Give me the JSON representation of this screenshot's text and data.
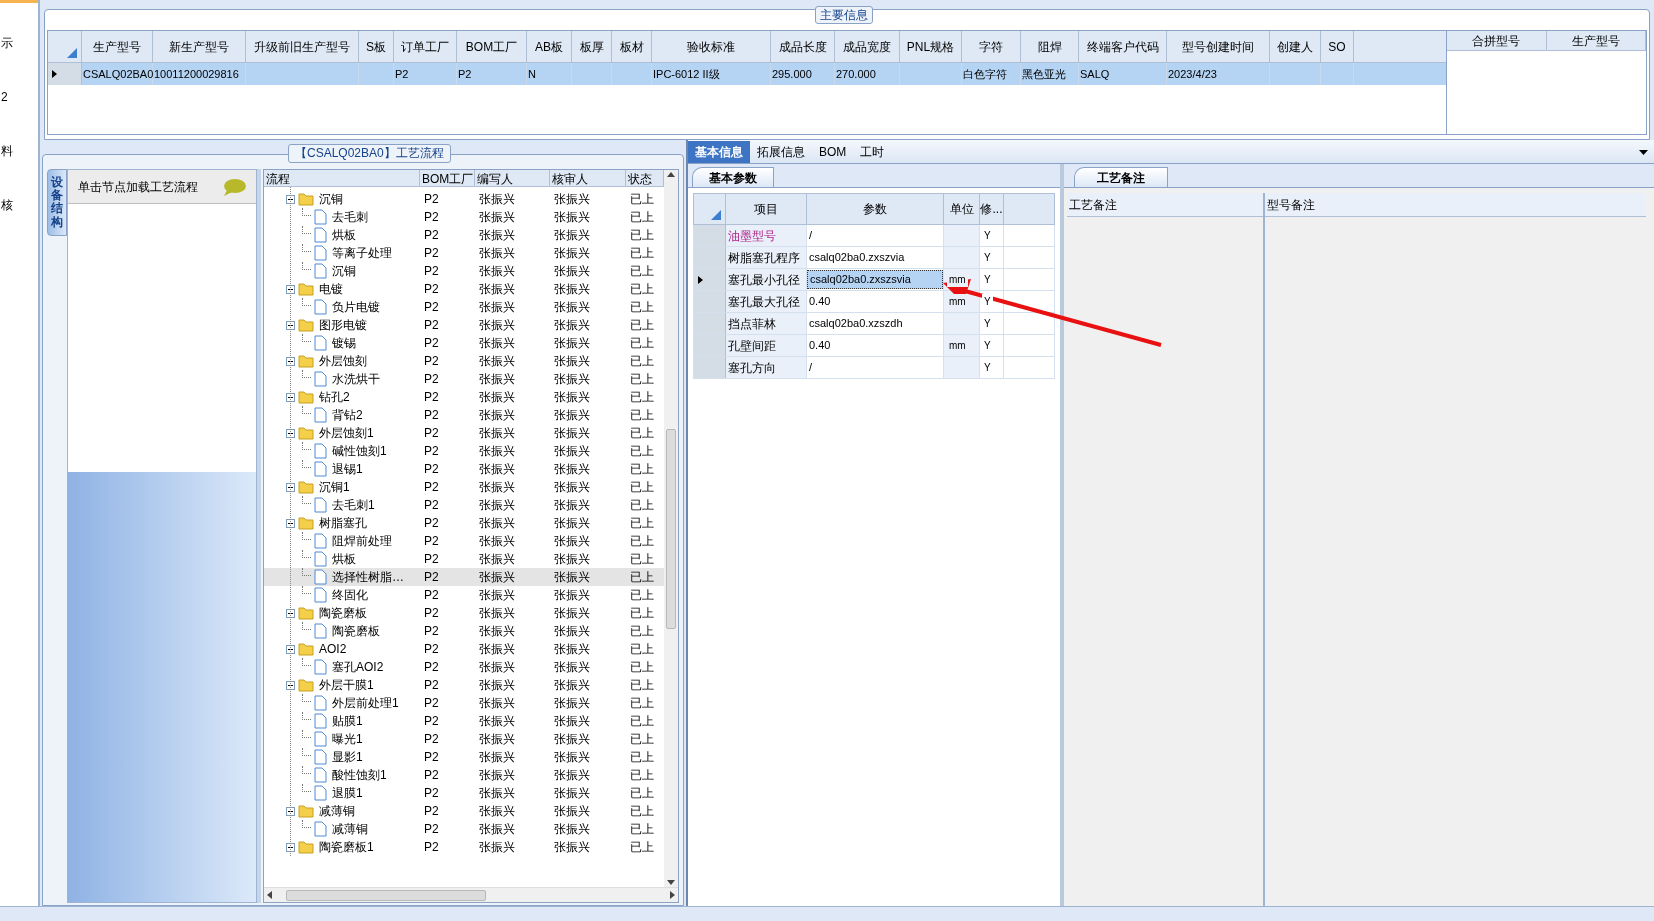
{
  "left_menu": [
    "示",
    "2",
    "料",
    "核"
  ],
  "main_info": {
    "title": "主要信息",
    "columns": [
      "生产型号",
      "新生产型号",
      "升级前旧生产型号",
      "S板",
      "订单工厂",
      "BOM工厂",
      "AB板",
      "板厚",
      "板材",
      "验收标准",
      "成品长度",
      "成品宽度",
      "PNL规格",
      "字符",
      "阻焊",
      "终端客户代码",
      "型号创建时间",
      "创建人",
      "SO"
    ],
    "rows": [
      {
        "selected": true,
        "cells": [
          "CSALQ02BA0",
          "10011200029816",
          null,
          null,
          "P2",
          "P2",
          "N",
          null,
          null,
          "IPC-6012 II级",
          "295.000",
          "270.000",
          null,
          "白色字符",
          "黑色亚光",
          "SALQ",
          "2023/4/23",
          null,
          null
        ]
      }
    ]
  },
  "merge_table": {
    "columns": [
      "合拼型号",
      "生产型号"
    ]
  },
  "process_flow": {
    "title": "【CSALQ02BA0】工艺流程",
    "side_tab": "设备结构",
    "hint": "单击节点加载工艺流程",
    "columns": [
      "流程",
      "BOM工厂",
      "编写人",
      "核审人",
      "状态"
    ],
    "tree": [
      {
        "name": "沉铜",
        "kind": "folder",
        "expanded": true,
        "bom": "P2",
        "writer": "张振兴",
        "reviewer": "张振兴",
        "status": "已上",
        "selected": false,
        "children": [
          {
            "name": "去毛刺",
            "kind": "file",
            "bom": "P2",
            "writer": "张振兴",
            "reviewer": "张振兴",
            "status": "已上",
            "selected": false
          },
          {
            "name": "烘板",
            "kind": "file",
            "bom": "P2",
            "writer": "张振兴",
            "reviewer": "张振兴",
            "status": "已上",
            "selected": false
          },
          {
            "name": "等离子处理",
            "kind": "file",
            "bom": "P2",
            "writer": "张振兴",
            "reviewer": "张振兴",
            "status": "已上",
            "selected": false
          },
          {
            "name": "沉铜",
            "kind": "file",
            "bom": "P2",
            "writer": "张振兴",
            "reviewer": "张振兴",
            "status": "已上",
            "selected": false
          }
        ]
      },
      {
        "name": "电镀",
        "kind": "folder",
        "expanded": true,
        "bom": "P2",
        "writer": "张振兴",
        "reviewer": "张振兴",
        "status": "已上",
        "selected": false,
        "children": [
          {
            "name": "负片电镀",
            "kind": "file",
            "bom": "P2",
            "writer": "张振兴",
            "reviewer": "张振兴",
            "status": "已上",
            "selected": false
          }
        ]
      },
      {
        "name": "图形电镀",
        "kind": "folder",
        "expanded": true,
        "bom": "P2",
        "writer": "张振兴",
        "reviewer": "张振兴",
        "status": "已上",
        "selected": false,
        "children": [
          {
            "name": "镀锡",
            "kind": "file",
            "bom": "P2",
            "writer": "张振兴",
            "reviewer": "张振兴",
            "status": "已上",
            "selected": false
          }
        ]
      },
      {
        "name": "外层蚀刻",
        "kind": "folder",
        "expanded": true,
        "bom": "P2",
        "writer": "张振兴",
        "reviewer": "张振兴",
        "status": "已上",
        "selected": false,
        "children": [
          {
            "name": "水洗烘干",
            "kind": "file",
            "bom": "P2",
            "writer": "张振兴",
            "reviewer": "张振兴",
            "status": "已上",
            "selected": false
          }
        ]
      },
      {
        "name": "钻孔2",
        "kind": "folder",
        "expanded": true,
        "bom": "P2",
        "writer": "张振兴",
        "reviewer": "张振兴",
        "status": "已上",
        "selected": false,
        "children": [
          {
            "name": "背钻2",
            "kind": "file",
            "bom": "P2",
            "writer": "张振兴",
            "reviewer": "张振兴",
            "status": "已上",
            "selected": false
          }
        ]
      },
      {
        "name": "外层蚀刻1",
        "kind": "folder",
        "expanded": true,
        "bom": "P2",
        "writer": "张振兴",
        "reviewer": "张振兴",
        "status": "已上",
        "selected": false,
        "children": [
          {
            "name": "碱性蚀刻1",
            "kind": "file",
            "bom": "P2",
            "writer": "张振兴",
            "reviewer": "张振兴",
            "status": "已上",
            "selected": false
          },
          {
            "name": "退锡1",
            "kind": "file",
            "bom": "P2",
            "writer": "张振兴",
            "reviewer": "张振兴",
            "status": "已上",
            "selected": false
          }
        ]
      },
      {
        "name": "沉铜1",
        "kind": "folder",
        "expanded": true,
        "bom": "P2",
        "writer": "张振兴",
        "reviewer": "张振兴",
        "status": "已上",
        "selected": false,
        "children": [
          {
            "name": "去毛刺1",
            "kind": "file",
            "bom": "P2",
            "writer": "张振兴",
            "reviewer": "张振兴",
            "status": "已上",
            "selected": false
          }
        ]
      },
      {
        "name": "树脂塞孔",
        "kind": "folder",
        "expanded": true,
        "bom": "P2",
        "writer": "张振兴",
        "reviewer": "张振兴",
        "status": "已上",
        "selected": false,
        "children": [
          {
            "name": "阻焊前处理",
            "kind": "file",
            "bom": "P2",
            "writer": "张振兴",
            "reviewer": "张振兴",
            "status": "已上",
            "selected": false
          },
          {
            "name": "烘板",
            "kind": "file",
            "bom": "P2",
            "writer": "张振兴",
            "reviewer": "张振兴",
            "status": "已上",
            "selected": false
          },
          {
            "name": "选择性树脂…",
            "kind": "file",
            "bom": "P2",
            "writer": "张振兴",
            "reviewer": "张振兴",
            "status": "已上",
            "selected": true
          },
          {
            "name": "终固化",
            "kind": "file",
            "bom": "P2",
            "writer": "张振兴",
            "reviewer": "张振兴",
            "status": "已上",
            "selected": false
          }
        ]
      },
      {
        "name": "陶瓷磨板",
        "kind": "folder",
        "expanded": true,
        "bom": "P2",
        "writer": "张振兴",
        "reviewer": "张振兴",
        "status": "已上",
        "selected": false,
        "children": [
          {
            "name": "陶瓷磨板",
            "kind": "file",
            "bom": "P2",
            "writer": "张振兴",
            "reviewer": "张振兴",
            "status": "已上",
            "selected": false
          }
        ]
      },
      {
        "name": "AOI2",
        "kind": "folder",
        "expanded": true,
        "bom": "P2",
        "writer": "张振兴",
        "reviewer": "张振兴",
        "status": "已上",
        "selected": false,
        "children": [
          {
            "name": "塞孔AOI2",
            "kind": "file",
            "bom": "P2",
            "writer": "张振兴",
            "reviewer": "张振兴",
            "status": "已上",
            "selected": false
          }
        ]
      },
      {
        "name": "外层干膜1",
        "kind": "folder",
        "expanded": true,
        "bom": "P2",
        "writer": "张振兴",
        "reviewer": "张振兴",
        "status": "已上",
        "selected": false,
        "children": [
          {
            "name": "外层前处理1",
            "kind": "file",
            "bom": "P2",
            "writer": "张振兴",
            "reviewer": "张振兴",
            "status": "已上",
            "selected": false
          },
          {
            "name": "贴膜1",
            "kind": "file",
            "bom": "P2",
            "writer": "张振兴",
            "reviewer": "张振兴",
            "status": "已上",
            "selected": false
          },
          {
            "name": "曝光1",
            "kind": "file",
            "bom": "P2",
            "writer": "张振兴",
            "reviewer": "张振兴",
            "status": "已上",
            "selected": false
          },
          {
            "name": "显影1",
            "kind": "file",
            "bom": "P2",
            "writer": "张振兴",
            "reviewer": "张振兴",
            "status": "已上",
            "selected": false
          },
          {
            "name": "酸性蚀刻1",
            "kind": "file",
            "bom": "P2",
            "writer": "张振兴",
            "reviewer": "张振兴",
            "status": "已上",
            "selected": false
          },
          {
            "name": "退膜1",
            "kind": "file",
            "bom": "P2",
            "writer": "张振兴",
            "reviewer": "张振兴",
            "status": "已上",
            "selected": false
          }
        ]
      },
      {
        "name": "减薄铜",
        "kind": "folder",
        "expanded": true,
        "bom": "P2",
        "writer": "张振兴",
        "reviewer": "张振兴",
        "status": "已上",
        "selected": false,
        "children": [
          {
            "name": "减薄铜",
            "kind": "file",
            "bom": "P2",
            "writer": "张振兴",
            "reviewer": "张振兴",
            "status": "已上",
            "selected": false
          }
        ]
      },
      {
        "name": "陶瓷磨板1",
        "kind": "folder",
        "expanded": true,
        "bom": "P2",
        "writer": "张振兴",
        "reviewer": "张振兴",
        "status": "已上",
        "selected": false
      }
    ]
  },
  "detail_tabs": [
    {
      "label": "基本信息",
      "selected": true
    },
    {
      "label": "拓展信息",
      "selected": false
    },
    {
      "label": "BOM",
      "selected": false
    },
    {
      "label": "工时",
      "selected": false
    }
  ],
  "params": {
    "tab": "基本参数",
    "columns": [
      "项目",
      "参数",
      "单位",
      "修..."
    ],
    "rows": [
      {
        "item": "油墨型号",
        "value": "/",
        "modified": "Y",
        "emphasized": true,
        "selected": false
      },
      {
        "item": "树脂塞孔程序",
        "value": "csalq02ba0.zxszvia",
        "modified": "Y",
        "emphasized": false,
        "selected": false
      },
      {
        "item": "塞孔最小孔径",
        "value": "csalq02ba0.zxszsvia",
        "unit": "mm",
        "modified": "Y",
        "emphasized": false,
        "selected": true
      },
      {
        "item": "塞孔最大孔径",
        "value": "0.40",
        "unit": "mm",
        "modified": "Y",
        "emphasized": false,
        "selected": false
      },
      {
        "item": "挡点菲林",
        "value": "csalq02ba0.xzszdh",
        "modified": "Y",
        "emphasized": false,
        "selected": false
      },
      {
        "item": "孔壁间距",
        "value": "0.40",
        "unit": "mm",
        "modified": "Y",
        "emphasized": false,
        "selected": false
      },
      {
        "item": "塞孔方向",
        "value": "/",
        "modified": "Y",
        "emphasized": false,
        "selected": false
      }
    ]
  },
  "remarks": {
    "tab": "工艺备注",
    "columns": [
      "工艺备注",
      "型号备注"
    ]
  }
}
